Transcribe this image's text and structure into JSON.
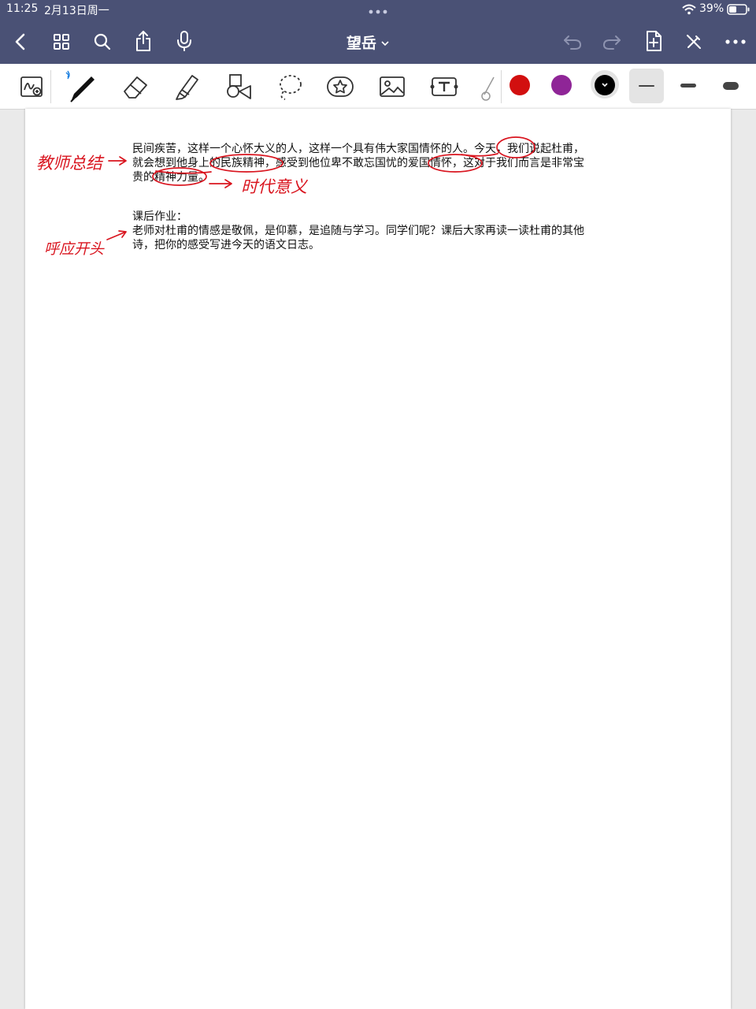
{
  "status_bar": {
    "time": "11:25",
    "date": "2月13日周一",
    "battery": "39%"
  },
  "nav": {
    "title": "望岳"
  },
  "toolbar": {
    "colors": [
      "#d20f0f",
      "#8f2597",
      "#000000"
    ],
    "selected_color_index": 2
  },
  "document": {
    "paragraph1": [
      "民间疾苦，这样一个心怀大义的人，这样一个具有伟大家国情怀的人。今天，我们说起杜甫，",
      "就会想到他身上的民族精神，感受到他位卑不敢忘国忧的爱国情怀，这对于我们而言是非常宝",
      "贵的精神力量。"
    ],
    "homework_title": "课后作业：",
    "paragraph2": [
      "老师对杜甫的情感是敬佩，是仰慕，是追随与学习。同学们呢？课后大家再读一读杜甫的其他",
      "诗，把你的感受写进今天的语文日志。"
    ]
  },
  "annotations": {
    "note_teacher_summary": "教师总结",
    "note_era_meaning": "时代意义",
    "note_echo_opening": "呼应开头",
    "ink_color": "#d9151f"
  }
}
